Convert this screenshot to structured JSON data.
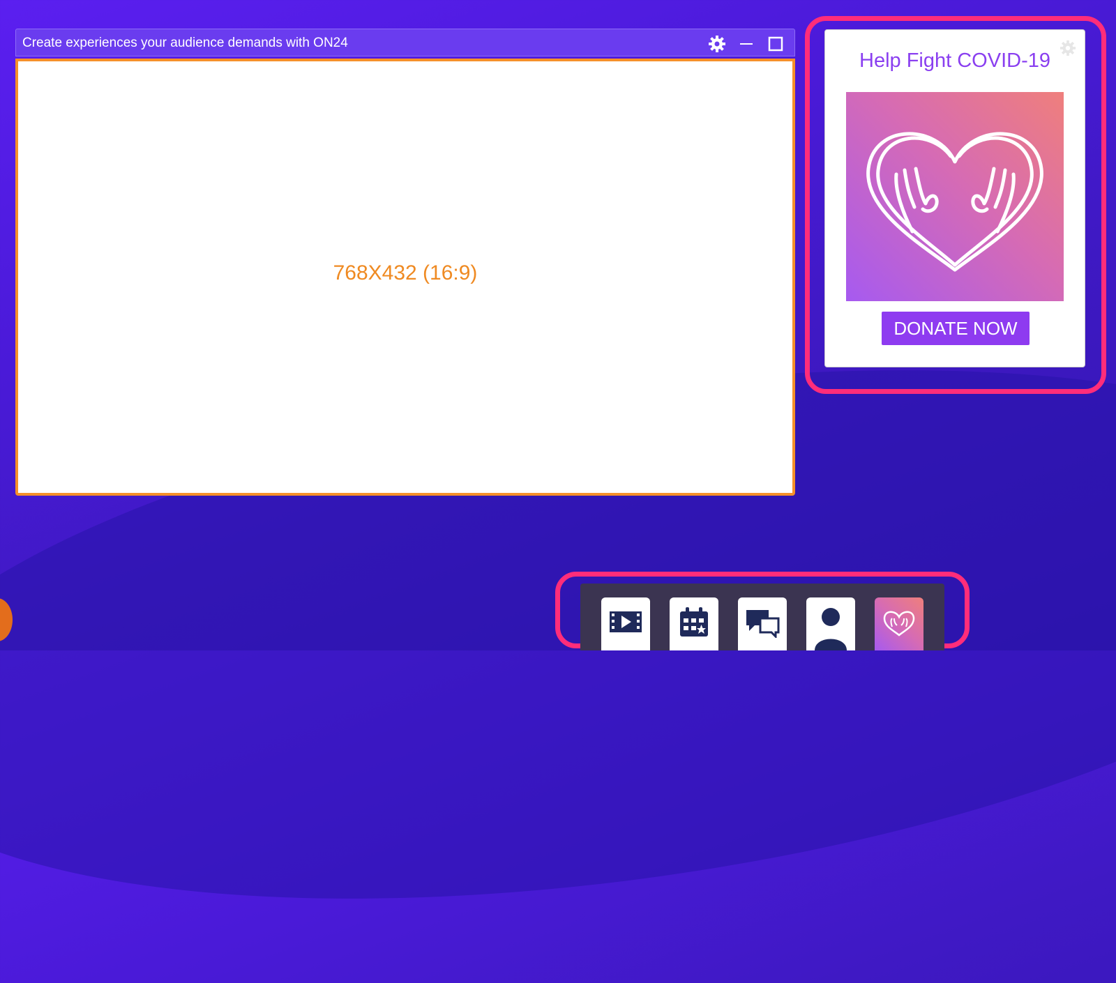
{
  "player": {
    "title": "Create experiences your audience demands with ON24",
    "placeholder_label": "768X432 (16:9)"
  },
  "widget": {
    "title": "Help Fight COVID-19",
    "button_label": "DONATE NOW"
  },
  "dock": {
    "items": [
      {
        "icon": "video-icon"
      },
      {
        "icon": "calendar-icon"
      },
      {
        "icon": "chat-icon"
      },
      {
        "icon": "person-icon"
      },
      {
        "icon": "heart-hands-icon"
      }
    ]
  },
  "colors": {
    "accent": "#8e3bf0",
    "highlight": "#ff2d7a",
    "player_border": "#f5902a"
  }
}
